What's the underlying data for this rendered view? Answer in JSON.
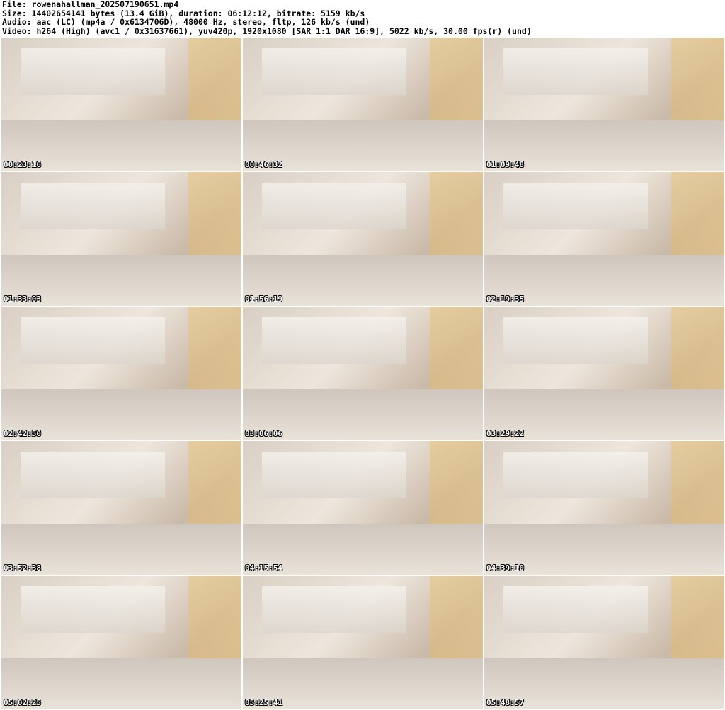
{
  "header": {
    "file": "File: rowenahallman_202507190651.mp4",
    "size": "Size: 14402654141 bytes (13.4 GiB), duration: 06:12:12, bitrate: 5159 kb/s",
    "audio": "Audio: aac (LC) (mp4a / 0x6134706D), 48000 Hz, stereo, fltp, 126 kb/s (und)",
    "video": "Video: h264 (High) (avc1 / 0x31637661), yuv420p, 1920x1080 [SAR 1:1 DAR 16:9], 5022 kb/s, 30.00 fps(r) (und)"
  },
  "thumbnails": [
    {
      "timestamp": "00:23:16"
    },
    {
      "timestamp": "00:46:32"
    },
    {
      "timestamp": "01:09:48"
    },
    {
      "timestamp": "01:33:03"
    },
    {
      "timestamp": "01:56:19"
    },
    {
      "timestamp": "02:19:35"
    },
    {
      "timestamp": "02:42:50"
    },
    {
      "timestamp": "03:06:06"
    },
    {
      "timestamp": "03:29:22"
    },
    {
      "timestamp": "03:52:38"
    },
    {
      "timestamp": "04:15:54"
    },
    {
      "timestamp": "04:39:10"
    },
    {
      "timestamp": "05:02:25"
    },
    {
      "timestamp": "05:25:41"
    },
    {
      "timestamp": "05:48:57"
    }
  ]
}
